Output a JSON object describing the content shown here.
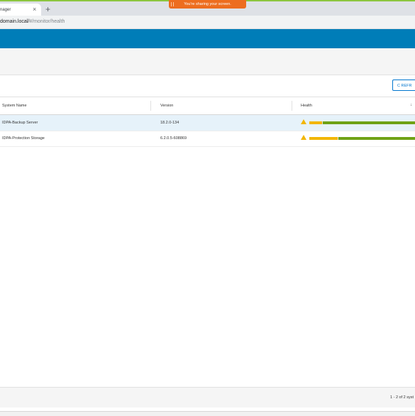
{
  "browser": {
    "tab_title": "nager",
    "close_glyph": "×",
    "new_tab_glyph": "+",
    "url_host": "domain.local/",
    "url_path": "#/monitor/health"
  },
  "sharing_banner": {
    "text": "You're sharing your screen."
  },
  "toolbar": {
    "refresh_label": "C REFR"
  },
  "table": {
    "columns": [
      "System Name",
      "Version",
      "Health"
    ],
    "sort_glyph": "↓",
    "rows": [
      {
        "system_name": "IDPA-Backup Server",
        "version": "18.2.0-134",
        "health_warning": 0.12,
        "health_ok": 0.88,
        "selected": true
      },
      {
        "system_name": "IDPA-Protection Storage",
        "version": "6.2.0.5-608869",
        "health_warning": 0.27,
        "health_ok": 0.73,
        "selected": false
      }
    ]
  },
  "footer": {
    "pager_text": "1 - 2 of 2 syst"
  },
  "colors": {
    "brand_blue": "#007db8",
    "sharing_orange": "#ed6d1f",
    "health_warning": "#f2b600",
    "health_ok": "#6fa215"
  },
  "icons": [
    "close-icon",
    "plus-icon",
    "refresh-icon",
    "sort-down-icon",
    "warning-icon"
  ]
}
